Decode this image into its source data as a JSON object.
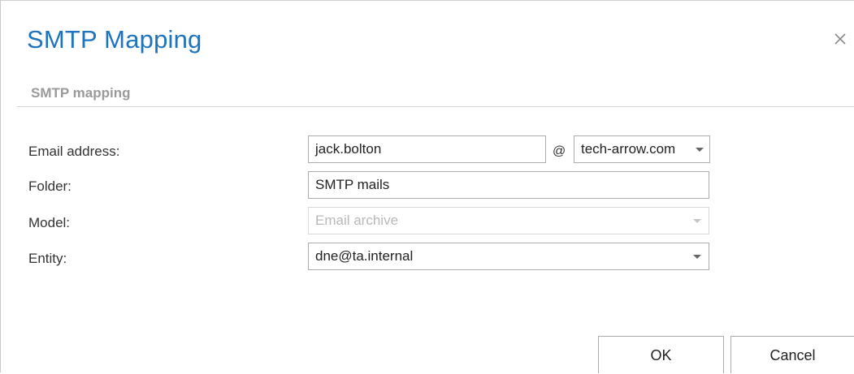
{
  "dialog": {
    "title": "SMTP Mapping",
    "close_icon": "close-icon"
  },
  "section": {
    "label": "SMTP mapping"
  },
  "form": {
    "email": {
      "label": "Email address:",
      "local_part": "jack.bolton",
      "at_symbol": "@",
      "domain": "tech-arrow.com"
    },
    "folder": {
      "label": "Folder:",
      "value": "SMTP mails"
    },
    "model": {
      "label": "Model:",
      "value": "Email archive",
      "disabled": true
    },
    "entity": {
      "label": "Entity:",
      "value": "dne@ta.internal"
    }
  },
  "buttons": {
    "ok_label": "OK",
    "cancel_label": "Cancel"
  },
  "colors": {
    "title": "#1e73be",
    "section_label": "#9a9a9a",
    "border": "#ababab"
  }
}
